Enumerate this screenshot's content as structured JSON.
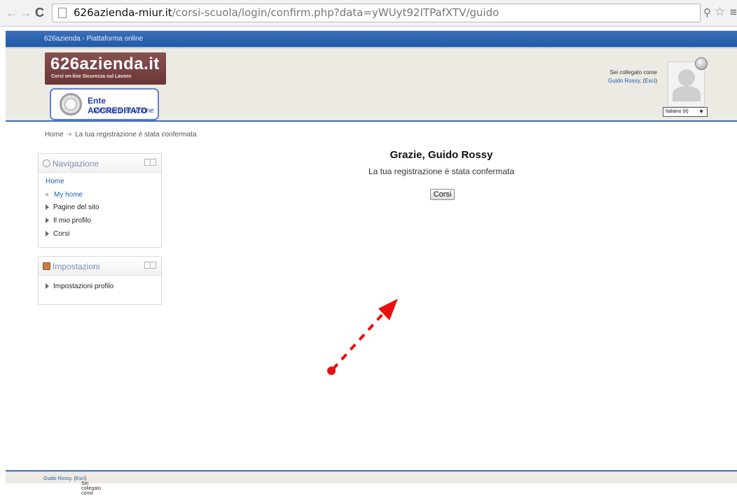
{
  "browser": {
    "url_host": "626azienda-miur.it",
    "url_path": "/corsi-scuola/login/confirm.php?data=yWUyt92ITPafXTV/guido"
  },
  "site": {
    "top_strip": "626azienda - Piattaforma online",
    "logo_name": "626azienda.it",
    "logo_tagline": "Corsi on-line Sicurezza sul Lavoro",
    "ente_line1": "Ente ACCREDITATO",
    "ente_line2": "Ministero Istruzione"
  },
  "user": {
    "logged_as": "Sei collegato come",
    "name": "Guido Rossy",
    "logout": "Esci",
    "language": "Italiano (it)"
  },
  "breadcrumb": {
    "home": "Home",
    "current": "La tua registrazione è stata confermata"
  },
  "navigation": {
    "title": "Navigazione",
    "home": "Home",
    "items": [
      {
        "label": "My home",
        "type": "dot"
      },
      {
        "label": "Pagine del sito",
        "type": "expand"
      },
      {
        "label": "Il mio profilo",
        "type": "expand"
      },
      {
        "label": "Corsi",
        "type": "expand"
      }
    ]
  },
  "settings": {
    "title": "Impostazioni",
    "items": [
      {
        "label": "Impostazioni profilo"
      }
    ]
  },
  "main": {
    "greeting": "Grazie, Guido Rossy",
    "message": "La tua registrazione è stata confermata",
    "button": "Corsi"
  },
  "footer": {
    "logged_as": "Sei collegato come",
    "name": "Guido Rossy",
    "logout": "Esci"
  },
  "colors": {
    "annotation_arrow": "#e8100f",
    "brand_blue": "#1f5aa8",
    "logo_maroon": "#6b3636"
  }
}
